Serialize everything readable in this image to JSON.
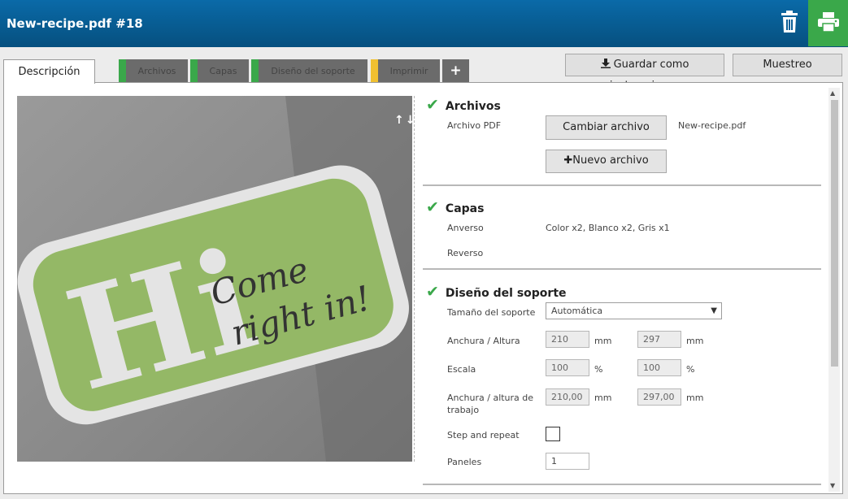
{
  "header": {
    "title": "New-recipe.pdf #18",
    "trash_icon": "trash-icon",
    "print_icon": "printer-icon",
    "colors": {
      "bar": "#0a6aa8",
      "print": "#3aa84a"
    }
  },
  "tabs": [
    {
      "label": "Descripción"
    },
    {
      "label": "Archivos",
      "status_color": "#3aa84a"
    },
    {
      "label": "Capas",
      "status_color": "#3aa84a"
    },
    {
      "label": "Diseño del soporte",
      "status_color": "#3aa84a"
    },
    {
      "label": "Imprimir",
      "status_color": "#f0c030"
    },
    {
      "label": "+"
    }
  ],
  "actions": {
    "save_label": "Guardar como instrucciones",
    "sample_label": "Muestreo"
  },
  "preview": {
    "big_text": "Hi",
    "script_line1": "Come",
    "script_line2": "right in!",
    "arrows": "↑↓"
  },
  "sections": {
    "archivos": {
      "title": "Archivos",
      "pdf_label": "Archivo PDF",
      "change_button": "Cambiar archivo",
      "filename": "New-recipe.pdf",
      "new_button": "Nuevo archivo"
    },
    "capas": {
      "title": "Capas",
      "front_label": "Anverso",
      "front_value": "Color x2, Blanco x2, Gris x1",
      "back_label": "Reverso"
    },
    "diseno": {
      "title": "Diseño del soporte",
      "size_label": "Tamaño del soporte",
      "size_value": "Automática",
      "wh_label": "Anchura / Altura",
      "width": "210",
      "height": "297",
      "unit_mm": "mm",
      "scale_label": "Escala",
      "scale_x": "100",
      "scale_y": "100",
      "unit_pct": "%",
      "work_label_1": "Anchura / altura de",
      "work_label_2": "trabajo",
      "work_w": "210,00",
      "work_h": "297,00",
      "step_label": "Step and repeat",
      "step_checked": false,
      "panels_label": "Paneles",
      "panels_value": "1"
    }
  }
}
